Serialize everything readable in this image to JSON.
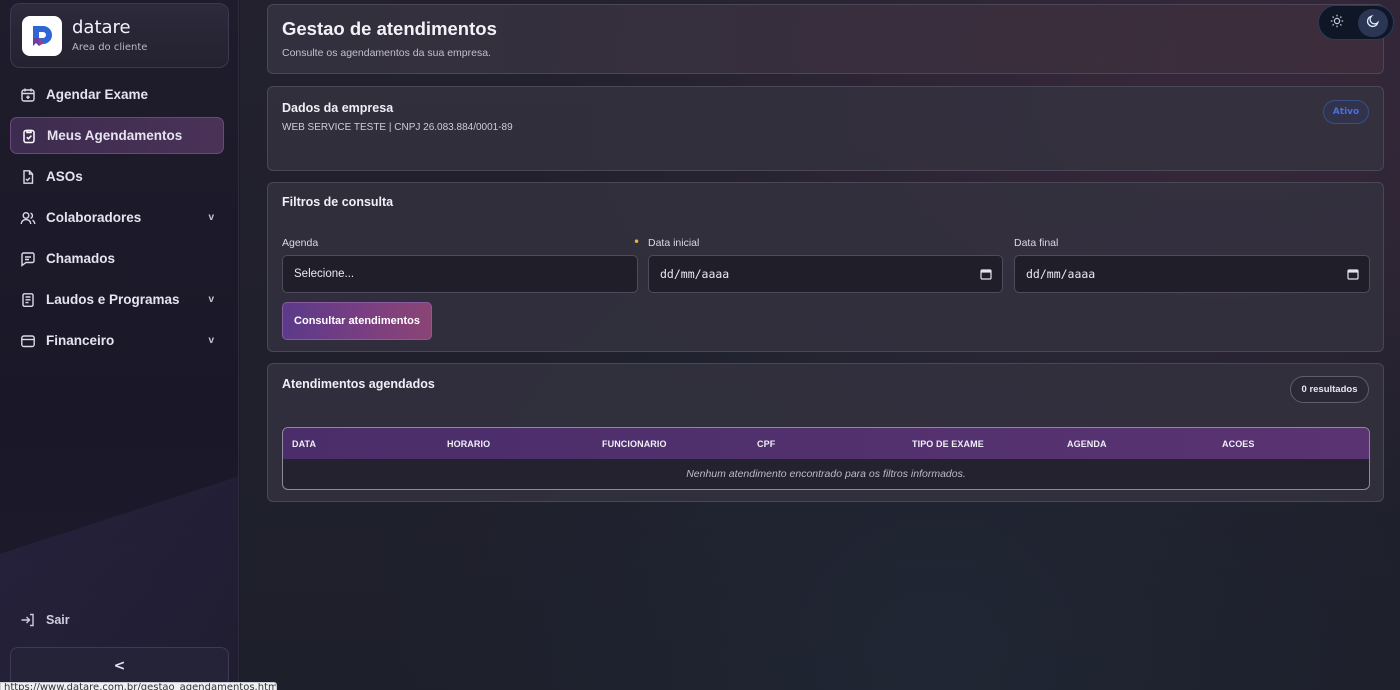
{
  "brand": {
    "name": "datare",
    "subtitle": "Area do cliente"
  },
  "sidebar": {
    "items": [
      {
        "label": "Agendar Exame",
        "icon": "calendar-plus-icon",
        "expandable": false,
        "active": false
      },
      {
        "label": "Meus Agendamentos",
        "icon": "clipboard-check-icon",
        "expandable": false,
        "active": true
      },
      {
        "label": "ASOs",
        "icon": "file-icon",
        "expandable": false,
        "active": false
      },
      {
        "label": "Colaboradores",
        "icon": "users-icon",
        "expandable": true,
        "active": false
      },
      {
        "label": "Chamados",
        "icon": "chat-icon",
        "expandable": true,
        "active": false
      },
      {
        "label": "Laudos e Programas",
        "icon": "document-list-icon",
        "expandable": true,
        "active": false
      },
      {
        "label": "Financeiro",
        "icon": "wallet-icon",
        "expandable": true,
        "active": false
      }
    ],
    "chevron": "v",
    "logout_label": "Sair",
    "collapse_label": "<"
  },
  "status_bar_url": "https://www.datare.com.br/gestao_agendamentos.html",
  "header": {
    "title": "Gestao de atendimentos",
    "subtitle": "Consulte os agendamentos da sua empresa."
  },
  "company": {
    "title": "Dados da empresa",
    "info": "WEB SERVICE TESTE | CNPJ 26.083.884/0001-89",
    "status": "Ativo"
  },
  "filters": {
    "title": "Filtros de consulta",
    "agenda_label": "Agenda",
    "agenda_value": "Selecione...",
    "required_mark": "•",
    "start_label": "Data inicial",
    "start_placeholder": "dd/mm/aaaa",
    "end_label": "Data final",
    "end_placeholder": "dd/mm/aaaa",
    "submit_label": "Consultar atendimentos"
  },
  "results": {
    "title": "Atendimentos agendados",
    "count": "0 resultados",
    "columns": [
      "DATA",
      "HORARIO",
      "FUNCIONARIO",
      "CPF",
      "TIPO DE EXAME",
      "AGENDA",
      "ACOES"
    ],
    "empty_message": "Nenhum atendimento encontrado para os filtros informados."
  },
  "colors": {
    "accent": "#5b3a8a",
    "accent_end": "#8a4574",
    "status_blue": "#4a6fe0",
    "required": "#e5b54a"
  }
}
